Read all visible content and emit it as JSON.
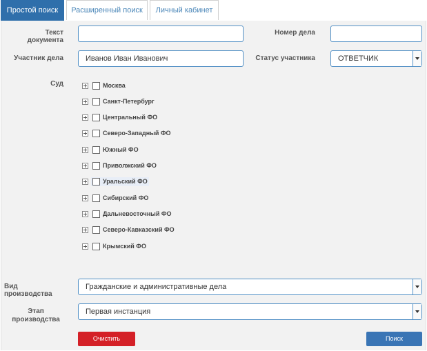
{
  "tabs": [
    {
      "label": "Простой поиск",
      "active": true
    },
    {
      "label": "Расширенный поиск",
      "active": false
    },
    {
      "label": "Личный кабинет",
      "active": false
    }
  ],
  "form": {
    "doc_text_label": "Текст документа",
    "doc_text_value": "",
    "case_number_label": "Номер дела",
    "case_number_value": "",
    "participant_label": "Участник дела",
    "participant_value": "Иванов Иван Иванович",
    "participant_status_label": "Статус участника",
    "participant_status_value": "ОТВЕТЧИК",
    "court_label": "Суд",
    "courts": [
      "Москва",
      "Санкт-Петербург",
      "Центральный ФО",
      "Северо-Западный ФО",
      "Южный ФО",
      "Приволжский ФО",
      "Уральский ФО",
      "Сибирский ФО",
      "Дальневосточный ФО",
      "Северо-Кавказский ФО",
      "Крымский ФО"
    ],
    "proceeding_type_label": "Вид производства",
    "proceeding_type_value": "Гражданские и административные дела",
    "stage_label_line1": "Этап",
    "stage_label_line2": "производства",
    "stage_value": "Первая инстанция"
  },
  "buttons": {
    "clear": "Очистить",
    "search": "Поиск"
  },
  "colors": {
    "active_tab": "#2f6fab",
    "clear_button": "#d42027",
    "search_button": "#3a75b5",
    "input_border": "#4f8ec4"
  }
}
